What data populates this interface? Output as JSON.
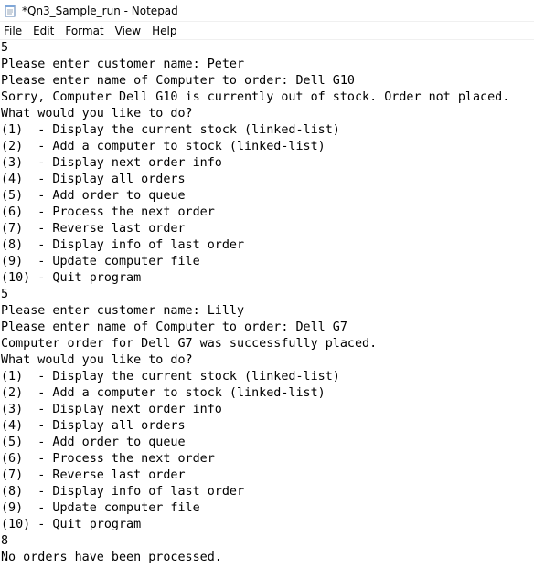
{
  "window": {
    "title": "*Qn3_Sample_run - Notepad",
    "icon": "notepad-icon"
  },
  "menu": {
    "items": [
      "File",
      "Edit",
      "Format",
      "View",
      "Help"
    ]
  },
  "editor": {
    "lines": [
      "5",
      "Please enter customer name: Peter",
      "Please enter name of Computer to order: Dell G10",
      "Sorry, Computer Dell G10 is currently out of stock. Order not placed.",
      "What would you like to do?",
      "(1)  - Display the current stock (linked-list)",
      "(2)  - Add a computer to stock (linked-list)",
      "(3)  - Display next order info",
      "(4)  - Display all orders",
      "(5)  - Add order to queue",
      "(6)  - Process the next order",
      "(7)  - Reverse last order",
      "(8)  - Display info of last order",
      "(9)  - Update computer file",
      "(10) - Quit program",
      "5",
      "Please enter customer name: Lilly",
      "Please enter name of Computer to order: Dell G7",
      "Computer order for Dell G7 was successfully placed.",
      "What would you like to do?",
      "(1)  - Display the current stock (linked-list)",
      "(2)  - Add a computer to stock (linked-list)",
      "(3)  - Display next order info",
      "(4)  - Display all orders",
      "(5)  - Add order to queue",
      "(6)  - Process the next order",
      "(7)  - Reverse last order",
      "(8)  - Display info of last order",
      "(9)  - Update computer file",
      "(10) - Quit program",
      "8",
      "No orders have been processed."
    ]
  }
}
